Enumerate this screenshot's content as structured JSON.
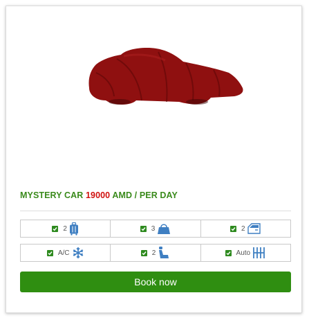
{
  "card": {
    "image": {
      "description_icon": "covered-car-icon"
    },
    "title": {
      "name": "MYSTERY CAR",
      "price": "19000",
      "unit": "AMD / PER DAY"
    },
    "features_row1": [
      {
        "value": "2",
        "icon": "suitcase-icon",
        "checked": true
      },
      {
        "value": "3",
        "icon": "handbag-icon",
        "checked": true
      },
      {
        "value": "2",
        "icon": "car-door-icon",
        "checked": true
      }
    ],
    "features_row2": [
      {
        "value": "A/C",
        "icon": "snowflake-icon",
        "checked": true
      },
      {
        "value": "2",
        "icon": "car-seat-icon",
        "checked": true
      },
      {
        "value": "Auto",
        "icon": "gearbox-icon",
        "checked": true
      }
    ],
    "book_button": {
      "label": "Book now"
    }
  },
  "colors": {
    "title_green": "#3a8a1b",
    "price_red": "#d0110e",
    "button_green": "#2f8e11",
    "icon_blue": "#3f7fc2",
    "car_cover_red": "#8f1010"
  }
}
